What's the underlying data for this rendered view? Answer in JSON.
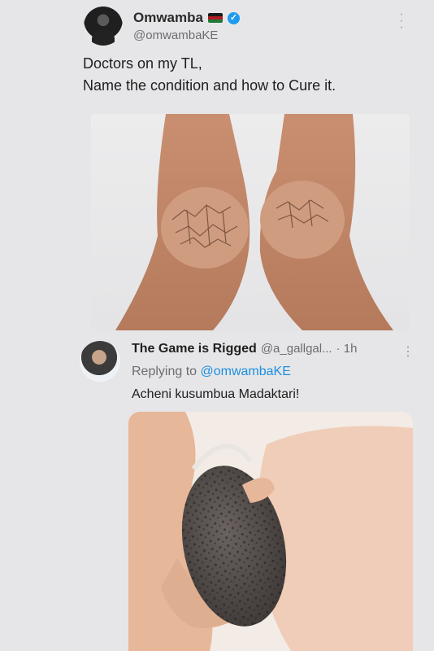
{
  "tweet": {
    "display_name": "Omwamba",
    "handle": "@omwambaKE",
    "flag_colors": [
      "#1a1a1a",
      "#f2f2f2",
      "#b11b23",
      "#f2f2f2",
      "#1f7a3a"
    ],
    "verified_icon": "verified-badge-icon",
    "menu_icon": "more-options-icon",
    "text_lines": [
      "Doctors on my TL,",
      "Name the condition and how to Cure it."
    ]
  },
  "reply": {
    "display_name": "The Game is Rigged",
    "handle": "@a_gallgal...",
    "time": "· 1h",
    "replying_prefix": "Replying to",
    "replying_to": "@omwambaKE",
    "text": "Acheni kusumbua Madaktari!",
    "menu_icon": "more-options-icon"
  },
  "colors": {
    "accent": "#1d9bf0",
    "mention": "#1d8fe0",
    "muted": "#6c6c72",
    "background": "#e6e6e8"
  }
}
